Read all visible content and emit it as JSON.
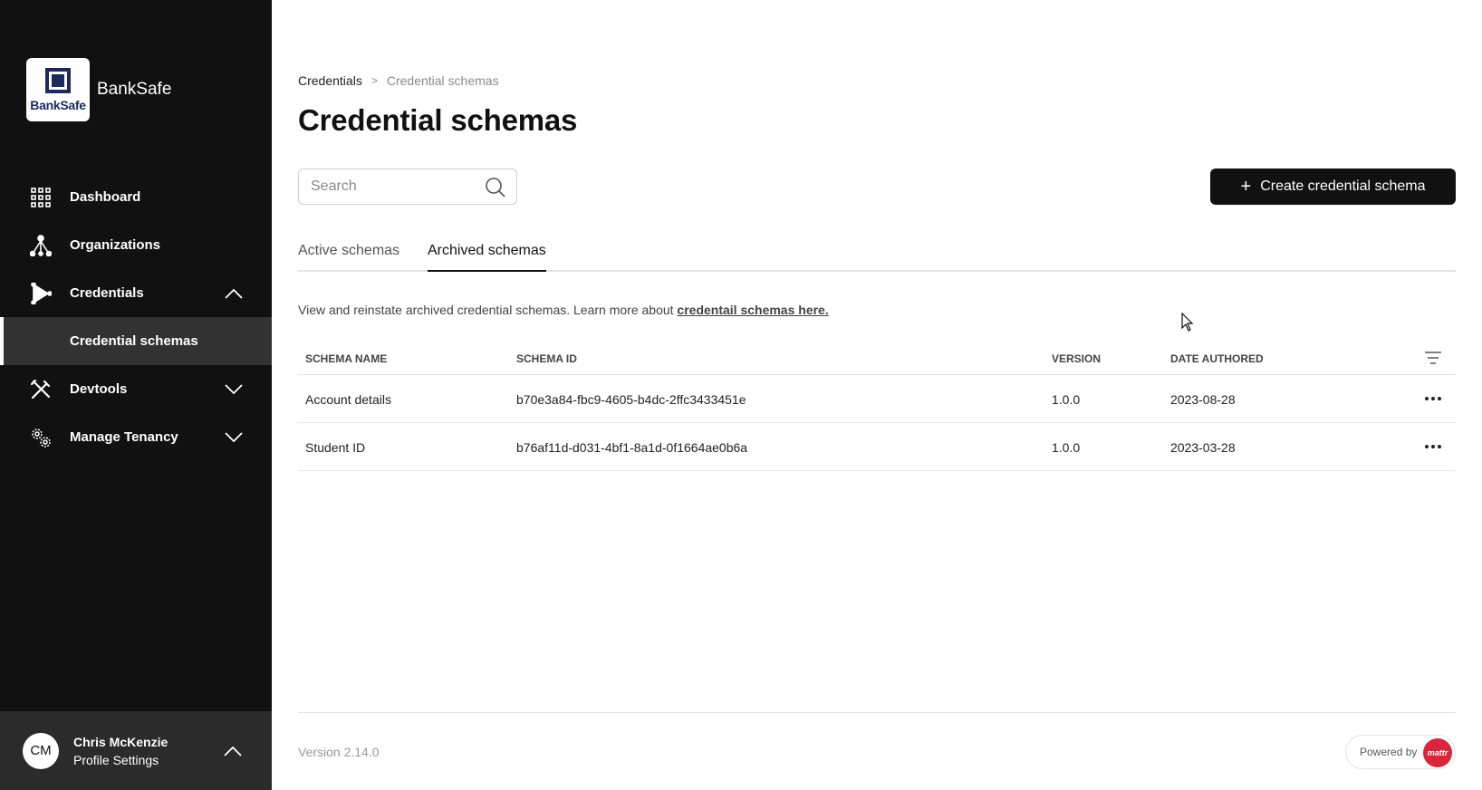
{
  "sidebar": {
    "logo_text": "BankSafe",
    "brand_name": "BankSafe",
    "items": [
      {
        "label": "Dashboard",
        "icon": "grid-icon"
      },
      {
        "label": "Organizations",
        "icon": "network-icon"
      },
      {
        "label": "Credentials",
        "icon": "credential-icon",
        "expanded": true
      },
      {
        "label": "Credential schemas",
        "active": true
      },
      {
        "label": "Devtools",
        "icon": "tools-icon",
        "expanded": false
      },
      {
        "label": "Manage Tenancy",
        "icon": "gears-icon",
        "expanded": false
      }
    ],
    "profile": {
      "initials": "CM",
      "name": "Chris McKenzie",
      "subtitle": "Profile Settings"
    }
  },
  "breadcrumb": {
    "parent": "Credentials",
    "separator": ">",
    "current": "Credential schemas"
  },
  "page_title": "Credential schemas",
  "search": {
    "placeholder": "Search",
    "value": ""
  },
  "create_button": {
    "label": "Create credential schema",
    "icon": "plus-icon"
  },
  "tabs": [
    {
      "label": "Active schemas",
      "active": false
    },
    {
      "label": "Archived schemas",
      "active": true
    }
  ],
  "info": {
    "text": "View and reinstate archived credential schemas. Learn more about ",
    "link_text": "credentail schemas here."
  },
  "table": {
    "columns": [
      "SCHEMA NAME",
      "SCHEMA ID",
      "VERSION",
      "DATE AUTHORED"
    ],
    "rows": [
      {
        "name": "Account details",
        "id": "b70e3a84-fbc9-4605-b4dc-2ffc3433451e",
        "version": "1.0.0",
        "date": "2023-08-28"
      },
      {
        "name": "Student ID",
        "id": "b76af11d-d031-4bf1-8a1d-0f1664ae0b6a",
        "version": "1.0.0",
        "date": "2023-03-28"
      }
    ]
  },
  "footer": {
    "version": "Version 2.14.0",
    "powered_by": "Powered by",
    "powered_logo": "mattr"
  },
  "colors": {
    "sidebar_bg": "#111111",
    "active_item_bg": "#323232",
    "primary_button": "#111111",
    "brand_red": "#d9263a"
  }
}
